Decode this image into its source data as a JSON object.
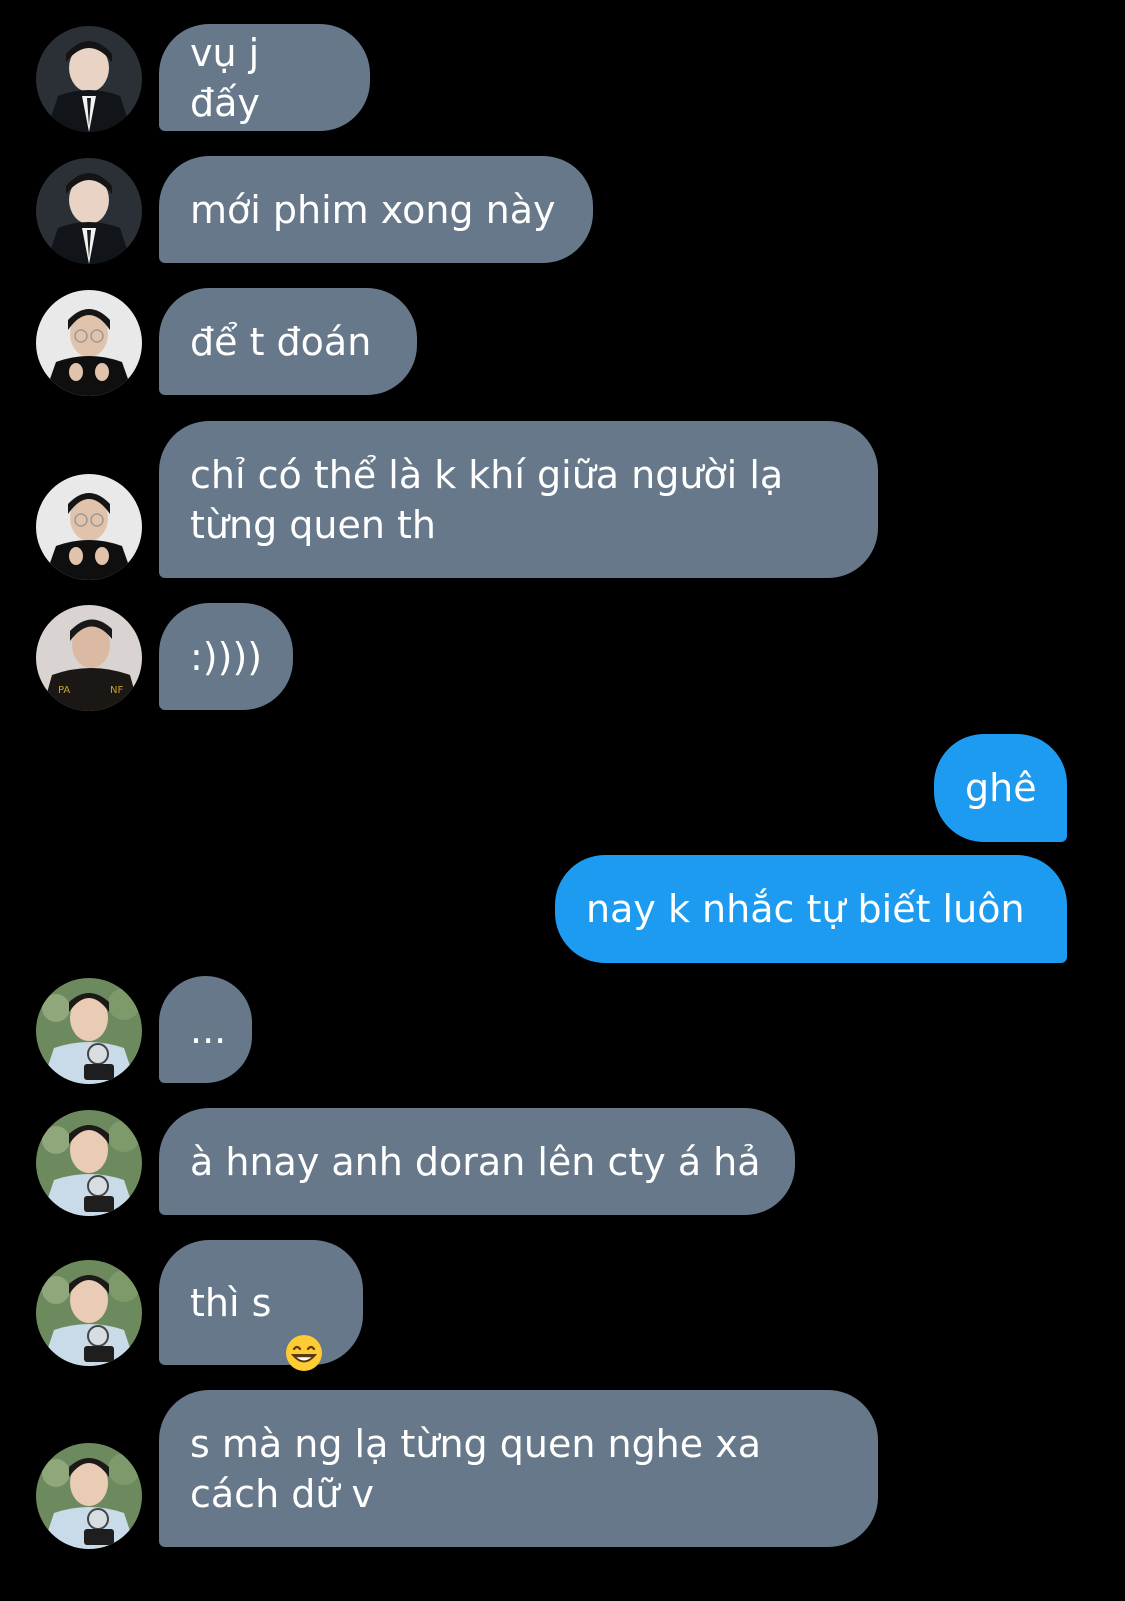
{
  "conversation": {
    "messages": [
      {
        "sender": "contact-1",
        "text": "vụ j đấy"
      },
      {
        "sender": "contact-1",
        "text": "mới phim xong này"
      },
      {
        "sender": "contact-2",
        "text": "để t đoán"
      },
      {
        "sender": "contact-2",
        "text": "chỉ có thể là k khí giữa người lạ\ntừng quen th"
      },
      {
        "sender": "contact-3",
        "text": ":))))"
      },
      {
        "sender": "me",
        "text": "ghê"
      },
      {
        "sender": "me",
        "text": "nay k nhắc tự biết luôn"
      },
      {
        "sender": "contact-4",
        "text": "..."
      },
      {
        "sender": "contact-4",
        "text": "à hnay anh doran lên cty á hả"
      },
      {
        "sender": "contact-4",
        "text": "thì s",
        "emoji": "grinning-face-with-smiling-eyes"
      },
      {
        "sender": "contact-4",
        "text": "s mà ng lạ từng quen nghe xa\ncách dữ v"
      }
    ]
  },
  "colors": {
    "background": "#000000",
    "incoming_bubble": "#66788a",
    "outgoing_bubble": "#1d9bf0",
    "text": "#ffffff"
  }
}
